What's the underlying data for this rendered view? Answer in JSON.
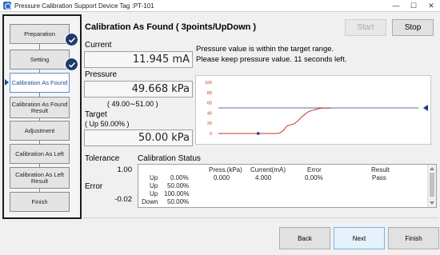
{
  "window": {
    "title": "Pressure Calibration Support  Device Tag :PT-101",
    "minimize": "—",
    "maximize": "☐",
    "close": "✕"
  },
  "steps": [
    {
      "label": "Preparation",
      "done": true
    },
    {
      "label": "Setting",
      "done": true
    },
    {
      "label": "Calibration As Found",
      "active": true
    },
    {
      "label": "Calibration As Found Result"
    },
    {
      "label": "Adjustment"
    },
    {
      "label": "Calibration As Left"
    },
    {
      "label": "Calibration As Left Result"
    },
    {
      "label": "Finish"
    }
  ],
  "header": {
    "title": "Calibration As Found ( 3points/UpDown )",
    "start_label": "Start",
    "stop_label": "Stop"
  },
  "current": {
    "label": "Current",
    "value": "11.945 mA"
  },
  "pressure": {
    "label": "Pressure",
    "value": "49.668 kPa",
    "range": "( 49.00∼51.00 )"
  },
  "target": {
    "label": "Target",
    "sub": "( Up 50.00% )",
    "value": "50.00 kPa"
  },
  "message": {
    "line1": "Pressure value is within the target range.",
    "line2": "Please keep pressure value. 11 seconds left."
  },
  "chart_data": {
    "type": "line",
    "y_ticks": [
      "100",
      "80",
      "60",
      "40",
      "20",
      "0"
    ],
    "ylim": [
      0,
      100
    ],
    "target": 50,
    "target_color": "#1f3a8a",
    "series_color": "#c0392b",
    "series": [
      {
        "values": [
          0,
          0,
          0,
          0,
          0,
          0,
          0,
          0,
          0,
          0,
          0,
          0,
          0,
          0,
          0,
          0,
          0,
          1,
          6,
          15,
          17,
          19,
          25,
          32,
          38,
          43,
          45,
          47,
          49,
          49.5,
          49.7,
          49.7
        ]
      }
    ],
    "marker_index": 11
  },
  "tolerance": {
    "label": "Tolerance",
    "value": "1.00"
  },
  "error": {
    "label": "Error",
    "value": "-0.02"
  },
  "status": {
    "title": "Calibration Status",
    "headers": [
      "Press.(kPa)",
      "Current(mA)",
      "Error",
      "Result"
    ],
    "rows": [
      {
        "dir": "Up",
        "point": "0.00%",
        "press": "0.000",
        "current": "4.000",
        "error": "0.00%",
        "result": "Pass"
      },
      {
        "dir": "Up",
        "point": "50.00%",
        "press": "",
        "current": "",
        "error": "",
        "result": ""
      },
      {
        "dir": "Up",
        "point": "100.00%",
        "press": "",
        "current": "",
        "error": "",
        "result": ""
      },
      {
        "dir": "Down",
        "point": "50.00%",
        "press": "",
        "current": "",
        "error": "",
        "result": ""
      }
    ]
  },
  "footer": {
    "back_label": "Back",
    "next_label": "Next",
    "finish_label": "Finish"
  }
}
